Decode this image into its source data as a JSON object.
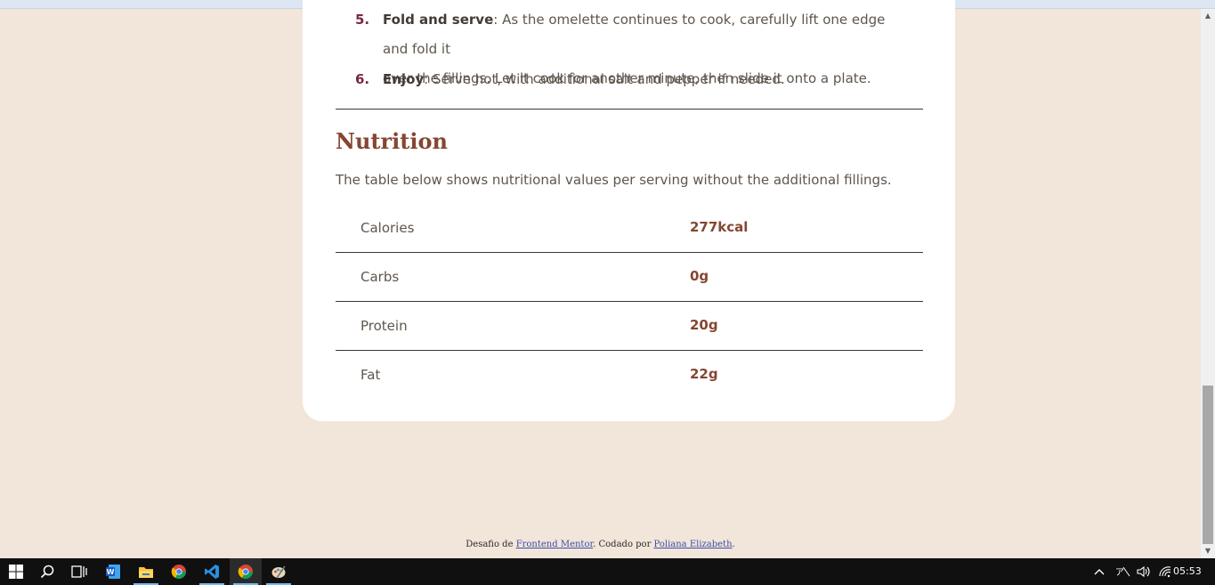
{
  "browser": {
    "top_strip_color": "#dde6f3"
  },
  "instructions": [
    {
      "number": "5.",
      "title": "Fold and serve",
      "line1": ": As the omelette continues to cook, carefully lift one edge and fold it",
      "line2": "over the fillings. Let it cook for another minute, then slide it onto a plate."
    },
    {
      "number": "6.",
      "title": "Enjoy",
      "line1": ": Serve hot, with additional salt and pepper if needed."
    }
  ],
  "nutrition": {
    "title": "Nutrition",
    "description": "The table below shows nutritional values per serving without the additional fillings.",
    "rows": [
      {
        "label": "Calories",
        "value": "277kcal"
      },
      {
        "label": "Carbs",
        "value": "0g"
      },
      {
        "label": "Protein",
        "value": "20g"
      },
      {
        "label": "Fat",
        "value": "22g"
      }
    ]
  },
  "footer": {
    "prefix": "Desafio de ",
    "link1": "Frontend Mentor",
    "middle": ". Codado por ",
    "link2": "Poliana Elizabeth",
    "suffix": "."
  },
  "taskbar": {
    "apps": [
      "start-icon",
      "search-icon",
      "task-view-icon",
      "word-icon",
      "file-explorer-icon",
      "chrome-icon",
      "vscode-icon",
      "chrome-active-icon",
      "paint-icon"
    ],
    "clock": "05:53"
  },
  "colors": {
    "background": "#f2e5da",
    "card": "#ffffff",
    "accent_brown": "#854632",
    "accent_rose": "#7a2847",
    "text": "#5f564d"
  }
}
